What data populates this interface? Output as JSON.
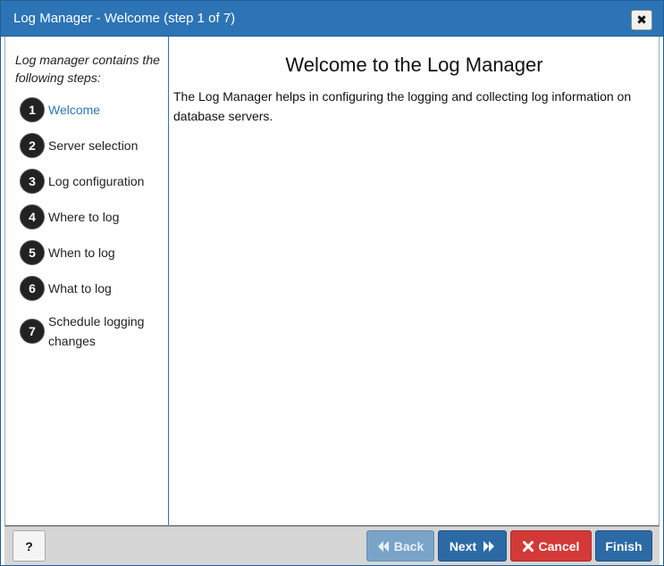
{
  "window": {
    "title": "Log Manager - Welcome (step 1 of 7)",
    "close_icon": "close-icon"
  },
  "sidebar": {
    "intro": "Log manager contains the following steps:",
    "steps": [
      {
        "number": "1",
        "label": "Welcome",
        "active": true
      },
      {
        "number": "2",
        "label": "Server selection",
        "active": false
      },
      {
        "number": "3",
        "label": "Log configuration",
        "active": false
      },
      {
        "number": "4",
        "label": "Where to log",
        "active": false
      },
      {
        "number": "5",
        "label": "When to log",
        "active": false
      },
      {
        "number": "6",
        "label": "What to log",
        "active": false
      },
      {
        "number": "7",
        "label": "Schedule logging changes",
        "active": false
      }
    ]
  },
  "main": {
    "title": "Welcome to the Log Manager",
    "description": "The Log Manager helps in configuring the logging and collecting log information on database servers."
  },
  "footer": {
    "help_label": "?",
    "back_label": "Back",
    "next_label": "Next",
    "cancel_label": "Cancel",
    "finish_label": "Finish"
  },
  "colors": {
    "titlebar": "#2c74b5",
    "active_step": "#2c74b5",
    "primary_button": "#2c6aa6",
    "disabled_button": "#7aa3c8",
    "cancel_button": "#d33a37"
  }
}
